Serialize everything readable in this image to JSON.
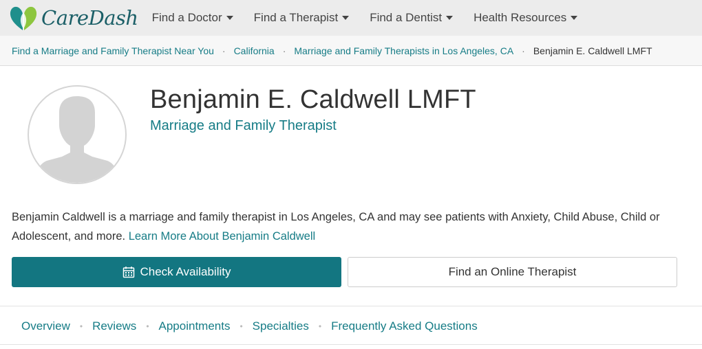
{
  "header": {
    "logo_text": "CareDash",
    "logo_icon": "caredash-heart-logo",
    "nav": [
      {
        "label": "Find a Doctor"
      },
      {
        "label": "Find a Therapist"
      },
      {
        "label": "Find a Dentist"
      },
      {
        "label": "Health Resources"
      }
    ]
  },
  "breadcrumb": {
    "items": [
      "Find a Marriage and Family Therapist Near You",
      "California",
      "Marriage and Family Therapists in Los Angeles, CA"
    ],
    "current": "Benjamin E. Caldwell LMFT",
    "separator": "·"
  },
  "profile": {
    "name": "Benjamin E. Caldwell LMFT",
    "title": "Marriage and Family Therapist",
    "avatar_icon": "default-avatar-silhouette",
    "bio_text": "Benjamin Caldwell is a marriage and family therapist in Los Angeles, CA and may see patients with Anxiety, Child Abuse, Child or Adolescent, and more. ",
    "bio_link": "Learn More About Benjamin Caldwell"
  },
  "actions": {
    "primary_label": "Check Availability",
    "primary_icon": "calendar-icon",
    "secondary_label": "Find an Online Therapist"
  },
  "tabs": {
    "items": [
      "Overview",
      "Reviews",
      "Appointments",
      "Specialties",
      "Frequently Asked Questions"
    ],
    "separator": "•"
  },
  "colors": {
    "brand_teal": "#137681",
    "link_teal": "#167c86",
    "logo_green": "#8dc63f",
    "nav_bg": "#ececec"
  }
}
